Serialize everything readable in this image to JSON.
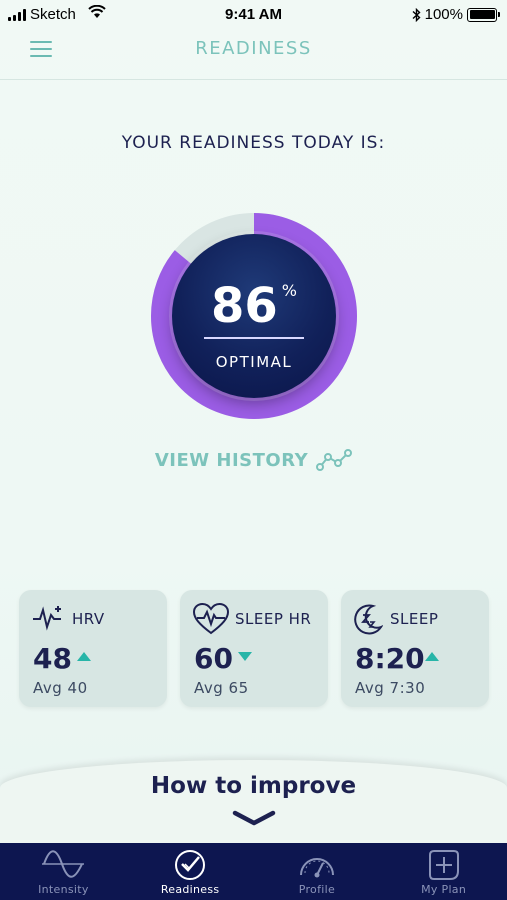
{
  "status_bar": {
    "carrier": "Sketch",
    "time": "9:41 AM",
    "battery": "100%"
  },
  "header": {
    "title": "READINESS",
    "menu_icon": "hamburger-menu-icon"
  },
  "readiness": {
    "heading": "YOUR READINESS TODAY IS:",
    "value": "86",
    "unit": "%",
    "percent": 86,
    "status": "OPTIMAL",
    "view_history": "VIEW HISTORY",
    "ring_color": "#9b5de5",
    "track_color": "#d9e5e3"
  },
  "metrics": [
    {
      "icon": "heart-rate-variability-icon",
      "label": "HRV",
      "value": "48",
      "trend": "up",
      "avg": "Avg 40"
    },
    {
      "icon": "heart-pulse-icon",
      "label": "SLEEP HR",
      "value": "60",
      "trend": "down",
      "avg": "Avg 65"
    },
    {
      "icon": "moon-sleep-icon",
      "label": "SLEEP",
      "value": "8:20",
      "trend": "up",
      "avg": "Avg 7:30"
    }
  ],
  "improve": {
    "title": "How to improve",
    "icon": "chevron-down-icon"
  },
  "tabs": [
    {
      "label": "Intensity",
      "icon": "sine-wave-icon",
      "active": false
    },
    {
      "label": "Readiness",
      "icon": "check-circle-icon",
      "active": true
    },
    {
      "label": "Profile",
      "icon": "speedometer-icon",
      "active": false
    },
    {
      "label": "My Plan",
      "icon": "plus-shield-icon",
      "active": false
    }
  ],
  "colors": {
    "accent": "#7cc3bb",
    "navy": "#1d2150",
    "tab_bar": "#0d1650",
    "trend": "#27b5a8"
  }
}
